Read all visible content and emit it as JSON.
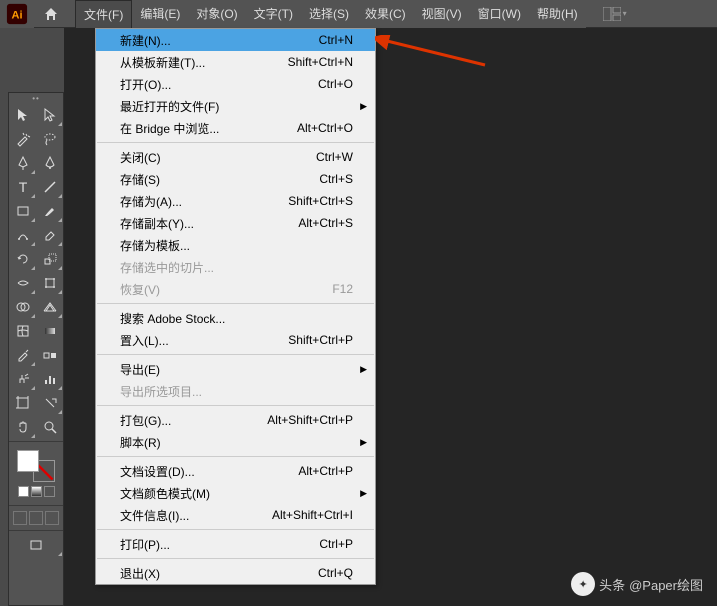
{
  "app": {
    "logo_text": "Ai"
  },
  "menubar": {
    "items": [
      {
        "label": "文件(F)",
        "active": true
      },
      {
        "label": "编辑(E)"
      },
      {
        "label": "对象(O)"
      },
      {
        "label": "文字(T)"
      },
      {
        "label": "选择(S)"
      },
      {
        "label": "效果(C)"
      },
      {
        "label": "视图(V)"
      },
      {
        "label": "窗口(W)"
      },
      {
        "label": "帮助(H)"
      }
    ]
  },
  "file_menu": [
    {
      "type": "item",
      "label": "新建(N)...",
      "shortcut": "Ctrl+N",
      "highlighted": true
    },
    {
      "type": "item",
      "label": "从模板新建(T)...",
      "shortcut": "Shift+Ctrl+N"
    },
    {
      "type": "item",
      "label": "打开(O)...",
      "shortcut": "Ctrl+O"
    },
    {
      "type": "item",
      "label": "最近打开的文件(F)",
      "submenu": true
    },
    {
      "type": "item",
      "label": "在 Bridge 中浏览...",
      "shortcut": "Alt+Ctrl+O"
    },
    {
      "type": "sep"
    },
    {
      "type": "item",
      "label": "关闭(C)",
      "shortcut": "Ctrl+W"
    },
    {
      "type": "item",
      "label": "存储(S)",
      "shortcut": "Ctrl+S"
    },
    {
      "type": "item",
      "label": "存储为(A)...",
      "shortcut": "Shift+Ctrl+S"
    },
    {
      "type": "item",
      "label": "存储副本(Y)...",
      "shortcut": "Alt+Ctrl+S"
    },
    {
      "type": "item",
      "label": "存储为模板..."
    },
    {
      "type": "item",
      "label": "存储选中的切片...",
      "disabled": true
    },
    {
      "type": "item",
      "label": "恢复(V)",
      "shortcut": "F12",
      "disabled": true
    },
    {
      "type": "sep"
    },
    {
      "type": "item",
      "label": "搜索 Adobe Stock..."
    },
    {
      "type": "item",
      "label": "置入(L)...",
      "shortcut": "Shift+Ctrl+P"
    },
    {
      "type": "sep"
    },
    {
      "type": "item",
      "label": "导出(E)",
      "submenu": true
    },
    {
      "type": "item",
      "label": "导出所选项目...",
      "disabled": true
    },
    {
      "type": "sep"
    },
    {
      "type": "item",
      "label": "打包(G)...",
      "shortcut": "Alt+Shift+Ctrl+P"
    },
    {
      "type": "item",
      "label": "脚本(R)",
      "submenu": true
    },
    {
      "type": "sep"
    },
    {
      "type": "item",
      "label": "文档设置(D)...",
      "shortcut": "Alt+Ctrl+P"
    },
    {
      "type": "item",
      "label": "文档颜色模式(M)",
      "submenu": true
    },
    {
      "type": "item",
      "label": "文件信息(I)...",
      "shortcut": "Alt+Shift+Ctrl+I"
    },
    {
      "type": "sep"
    },
    {
      "type": "item",
      "label": "打印(P)...",
      "shortcut": "Ctrl+P"
    },
    {
      "type": "sep"
    },
    {
      "type": "item",
      "label": "退出(X)",
      "shortcut": "Ctrl+Q"
    }
  ],
  "watermark": {
    "prefix": "头条",
    "text": "@Paper绘图"
  },
  "colors": {
    "highlight": "#4ba3e3",
    "panel": "#535353",
    "canvas": "#252525",
    "ai_orange": "#ff9a00"
  }
}
